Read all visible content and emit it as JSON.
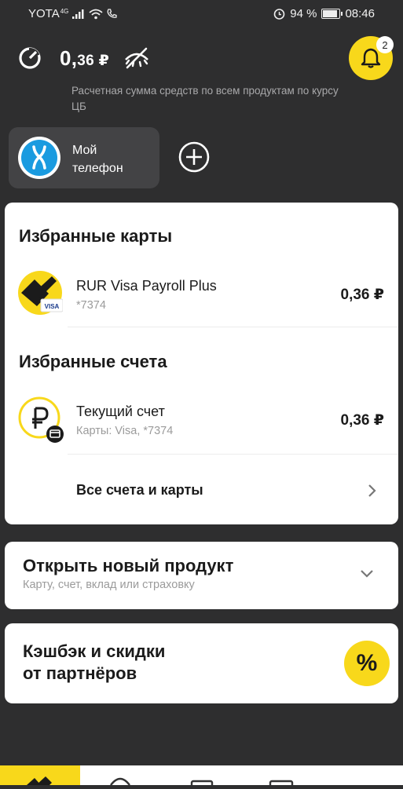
{
  "status_bar": {
    "carrier": "YOTA",
    "network": "4G",
    "battery": "94 %",
    "battery_level": 0.94,
    "time": "08:46"
  },
  "header": {
    "balance_int": "0,",
    "balance_frac": "36 ₽",
    "subtitle": "Расчетная сумма средств по всем продуктам по курсу ЦБ",
    "notifications_count": "2"
  },
  "quick": {
    "phone_label": "Мой телефон"
  },
  "favorites": {
    "cards_title": "Избранные карты",
    "card": {
      "name": "RUR Visa Payroll Plus",
      "number": "*7374",
      "amount": "0,36 ₽",
      "brand": "VISA"
    },
    "accounts_title": "Избранные счета",
    "account": {
      "name": "Текущий счет",
      "detail": "Карты: Visa, *7374",
      "amount": "0,36 ₽"
    },
    "all_link": "Все счета и карты"
  },
  "new_product": {
    "title": "Открыть новый продукт",
    "subtitle": "Карту, счет, вклад или страховку"
  },
  "cashback": {
    "line1": "Кэшбэк и скидки",
    "line2": "от партнёров",
    "icon": "%"
  },
  "colors": {
    "accent": "#f8d81b",
    "background": "#2e2e2f",
    "card": "#ffffff"
  }
}
